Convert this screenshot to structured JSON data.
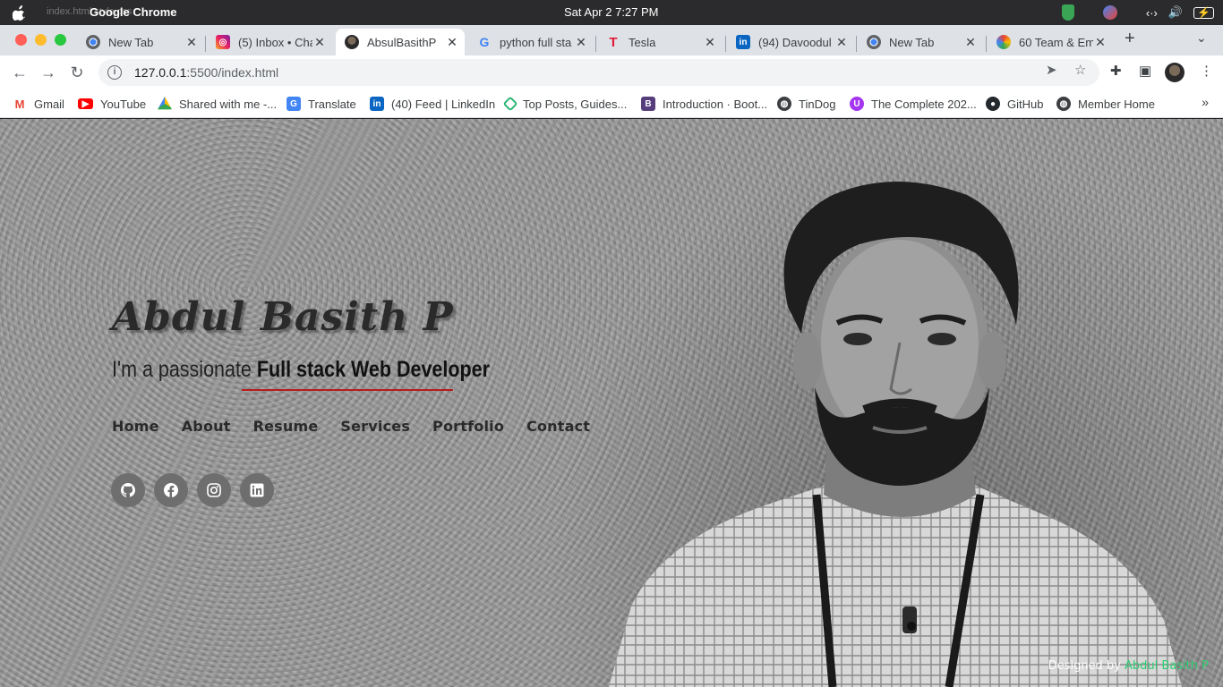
{
  "menubar": {
    "app_name": "Google Chrome",
    "ghost_tab_text": "index.html    style.css",
    "clock": "Sat Apr 2   7:27 PM"
  },
  "tabs": [
    {
      "title": "New Tab",
      "icon": "chrome-icon",
      "active": false
    },
    {
      "title": "(5) Inbox • Cha",
      "icon": "instagram-icon",
      "active": false
    },
    {
      "title": "AbsulBasithP",
      "icon": "profile-icon",
      "active": true
    },
    {
      "title": "python full sta",
      "icon": "google-icon",
      "active": false
    },
    {
      "title": "Tesla",
      "icon": "tesla-icon",
      "active": false
    },
    {
      "title": "(94) Davoodul",
      "icon": "linkedin-icon",
      "active": false
    },
    {
      "title": "New Tab",
      "icon": "chrome-icon",
      "active": false
    },
    {
      "title": "60 Team & Em",
      "icon": "colorful-icon",
      "active": false
    }
  ],
  "toolbar": {
    "url_host": "127.0.0.1",
    "url_path": ":5500/index.html"
  },
  "bookmarks": [
    {
      "label": "Gmail",
      "icon": "gmail-icon"
    },
    {
      "label": "YouTube",
      "icon": "youtube-icon"
    },
    {
      "label": "Shared with me -...",
      "icon": "drive-icon"
    },
    {
      "label": "Translate",
      "icon": "translate-icon"
    },
    {
      "label": "(40) Feed | LinkedIn",
      "icon": "linkedin-icon"
    },
    {
      "label": "Top Posts, Guides...",
      "icon": "posts-icon"
    },
    {
      "label": "Introduction · Boot...",
      "icon": "bootstrap-icon"
    },
    {
      "label": "TinDog",
      "icon": "globe-icon"
    },
    {
      "label": "The Complete 202...",
      "icon": "udemy-icon"
    },
    {
      "label": "GitHub",
      "icon": "github-icon"
    },
    {
      "label": "Member Home",
      "icon": "globe-icon"
    }
  ],
  "hero": {
    "name": "Abdul Basith P",
    "tagline_prefix": "I'm a passionate ",
    "tagline_highlight": "Full stack Web Developer"
  },
  "nav": [
    "Home",
    "About",
    "Resume",
    "Services",
    "Portfolio",
    "Contact"
  ],
  "socials": [
    "github-icon",
    "facebook-icon",
    "instagram-icon",
    "linkedin-icon"
  ],
  "footer": {
    "prefix": "Designed by ",
    "author": "Abdul Basith P"
  },
  "colors": {
    "underline": "#b71c1c",
    "footer_author": "#2ecc71"
  }
}
